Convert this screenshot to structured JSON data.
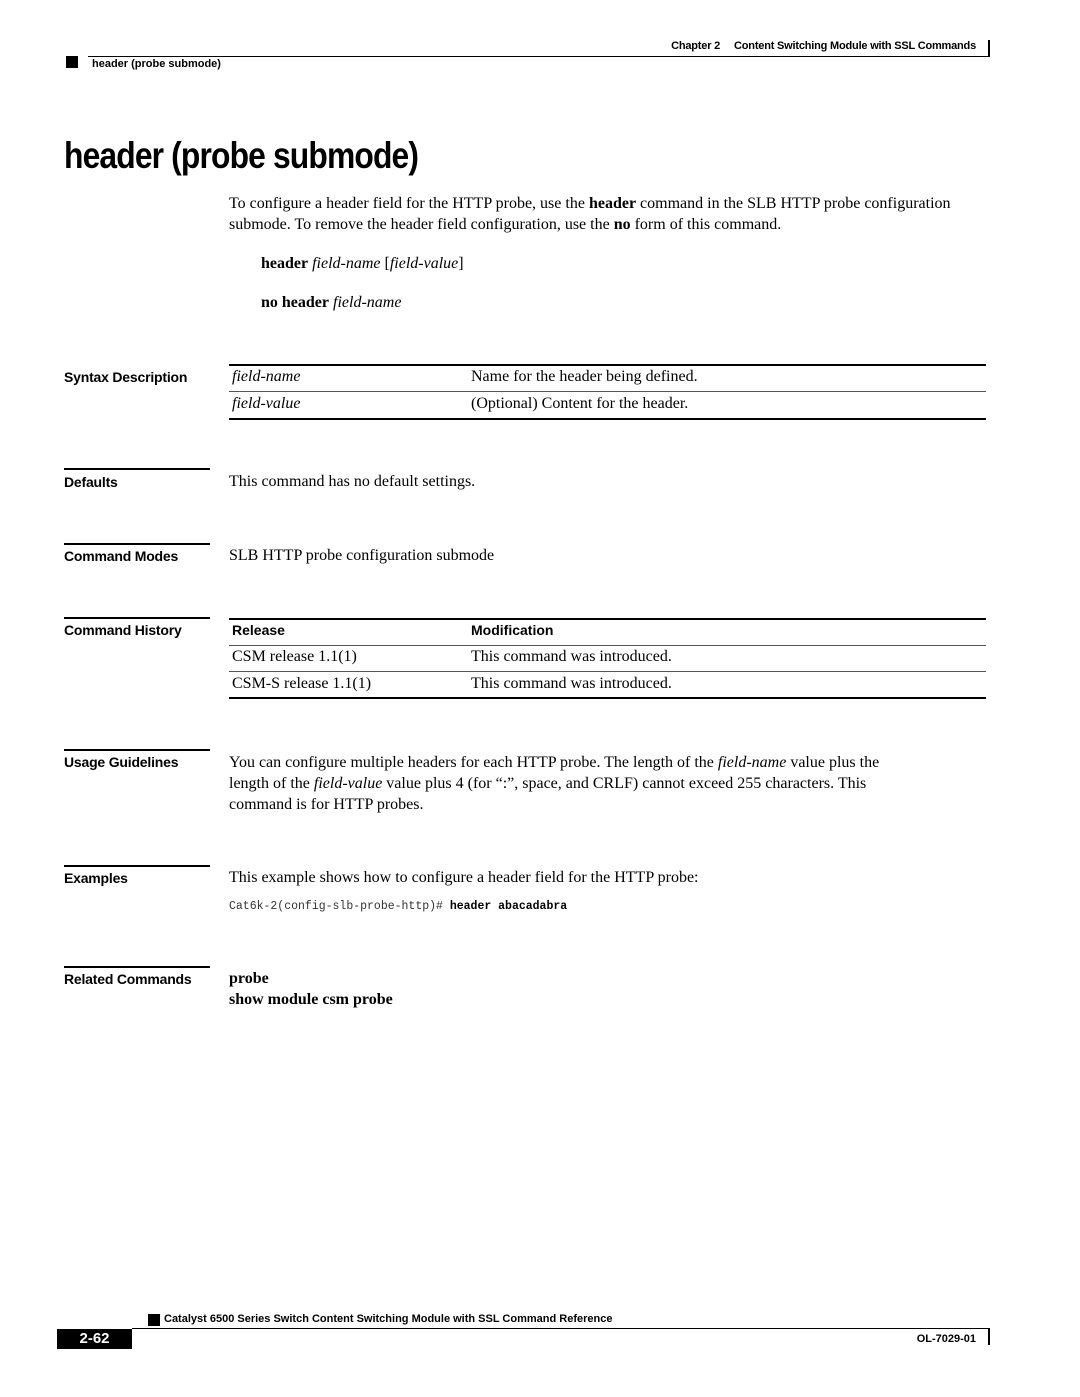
{
  "running_header": {
    "chapter_label": "Chapter 2",
    "chapter_title": "Content Switching Module with SSL Commands",
    "section": "header (probe submode)"
  },
  "title": "header (probe submode)",
  "intro": {
    "part1": "To configure a header field for the HTTP probe, use the ",
    "bold1": "header",
    "part2": " command in the SLB HTTP probe configuration submode. To remove the header field configuration, use the ",
    "bold2": "no",
    "part3": " form of this command."
  },
  "syntax": [
    {
      "cmd": "header",
      "arg": "field-name",
      "open": " [",
      "opt": "field-value",
      "close": "]"
    },
    {
      "cmd": "no header",
      "arg": "field-name"
    }
  ],
  "sections": {
    "syntax_description": {
      "heading": "Syntax Description",
      "rows": [
        {
          "param": "field-name",
          "desc": "Name for the header being defined."
        },
        {
          "param": "field-value",
          "desc": "(Optional) Content for the header."
        }
      ]
    },
    "defaults": {
      "heading": "Defaults",
      "text": "This command has no default settings."
    },
    "command_modes": {
      "heading": "Command Modes",
      "text": "SLB HTTP probe configuration submode"
    },
    "command_history": {
      "heading": "Command History",
      "columns": [
        "Release",
        "Modification"
      ],
      "rows": [
        {
          "release": "CSM release 1.1(1)",
          "modification": "This command was introduced."
        },
        {
          "release": "CSM-S release 1.1(1)",
          "modification": "This command was introduced."
        }
      ]
    },
    "usage_guidelines": {
      "heading": "Usage Guidelines",
      "line1a": "You can configure multiple headers for each HTTP probe. The length of the ",
      "line1i": "field-name",
      "line1b": " value plus the",
      "line2a": "length of the ",
      "line2i": "field-value",
      "line2b": " value plus 4 (for “:”, space, and CRLF) cannot exceed 255 characters. This",
      "line3": "command is for HTTP probes."
    },
    "examples": {
      "heading": "Examples",
      "text": "This example shows how to configure a header field for the HTTP probe:",
      "prompt": "Cat6k-2(config-slb-probe-http)# ",
      "command": "header abacadabra"
    },
    "related_commands": {
      "heading": "Related Commands",
      "items": [
        "probe",
        "show module csm probe"
      ]
    }
  },
  "footer": {
    "book_title": "Catalyst 6500 Series Switch Content Switching Module with SSL Command Reference",
    "page_number": "2-62",
    "doc_number": "OL-7029-01"
  }
}
